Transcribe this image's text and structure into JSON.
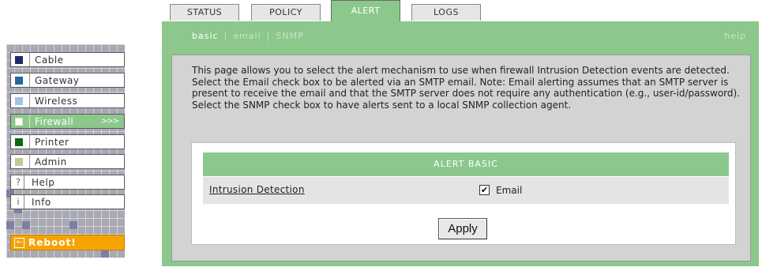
{
  "sidebar": {
    "items": [
      {
        "label": "Cable",
        "color": "#1e2a6e"
      },
      {
        "label": "Gateway",
        "color": "#1f6a9e"
      },
      {
        "label": "Wireless",
        "color": "#9fc4ea"
      },
      {
        "label": "Firewall",
        "color": "#ffffff",
        "arrow": ">>>"
      },
      {
        "label": "Printer",
        "color": "#0a6a14"
      },
      {
        "label": "Admin",
        "color": "#c6c69a"
      },
      {
        "label": "Help",
        "glyph": "?"
      },
      {
        "label": "Info",
        "glyph": "i"
      }
    ],
    "reboot": {
      "label": "Reboot!",
      "glyph": "←"
    }
  },
  "tabs": [
    {
      "label": "STATUS"
    },
    {
      "label": "POLICY"
    },
    {
      "label": "ALERT",
      "active": true
    },
    {
      "label": "LOGS"
    }
  ],
  "subnav": {
    "current": "basic",
    "links": [
      "email",
      "SNMP"
    ],
    "help": "help"
  },
  "description": "This page allows you to select the alert mechanism to use when firewall Intrusion Detection events are detected. Select the Email check box to be alerted via an SMTP email. Note: Email alerting assumes that an SMTP server is present to receive the email and that the SMTP server does not require any authentication (e.g., user-id/password). Select the SNMP check box to have alerts sent to a local SNMP collection agent.",
  "alert_table": {
    "header": "ALERT BASIC",
    "row_label": "Intrusion Detection",
    "checkbox_label": "Email",
    "checkbox_checked": true,
    "checkbox_mark": "✔"
  },
  "apply_label": "Apply",
  "colors": {
    "accent": "#8cc88c",
    "reboot": "#f5a300"
  }
}
